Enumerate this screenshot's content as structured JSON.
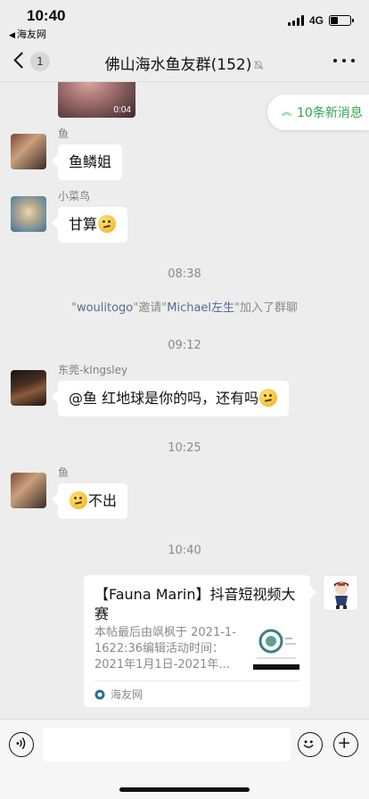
{
  "status_bar": {
    "time": "10:40",
    "back_app": "海友网",
    "network": "4G",
    "battery_fraction": 0.4
  },
  "nav": {
    "unread_count": "1",
    "title": "佛山海水鱼友群(152)"
  },
  "video": {
    "duration": "0:04"
  },
  "new_messages": "10条新消息",
  "messages": [
    {
      "sender": "鱼",
      "text": "鱼鳞姐"
    },
    {
      "sender": "小菜鸟",
      "text": "甘算"
    },
    {
      "sender": "东莞-kIngsley",
      "text": "@鱼 红地球是你的吗，还有吗"
    },
    {
      "sender": "鱼",
      "text": "不出"
    }
  ],
  "timestamps": [
    "08:38",
    "09:12",
    "10:25",
    "10:40"
  ],
  "system_notice": {
    "q1": "\"",
    "inviter": "woulitogo",
    "mid": "\"邀请\"",
    "invitee": "Michael左生",
    "tail": "\"加入了群聊"
  },
  "link_card": {
    "title": "【Fauna Marin】抖音短视频大赛",
    "description": "本帖最后由飒枫于 2021-1-1622:36编辑活动时间：2021年1月1日-2021年...",
    "source": "海友网"
  },
  "input": {
    "placeholder": ""
  },
  "colors": {
    "background": "#ededed",
    "link": "#576b95",
    "accent_green": "#2fa54a"
  }
}
